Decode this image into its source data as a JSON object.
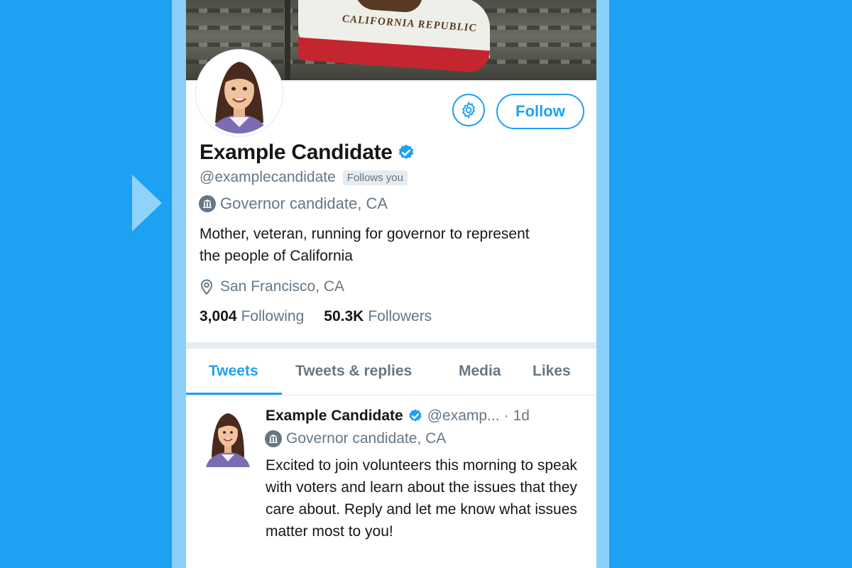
{
  "banner": {
    "flag_text": "CALIFORNIA REPUBLIC"
  },
  "profile": {
    "name": "Example Candidate",
    "handle": "@examplecandidate",
    "follows_you": "Follows you",
    "label": "Governor candidate, CA",
    "bio": "Mother, veteran, running for governor to represent the people of California",
    "location": "San Francisco, CA",
    "following_count": "3,004",
    "following_label": "Following",
    "followers_count": "50.3K",
    "followers_label": "Followers",
    "follow_button": "Follow"
  },
  "tabs": [
    {
      "label": "Tweets",
      "active": true
    },
    {
      "label": "Tweets & replies",
      "active": false
    },
    {
      "label": "Media",
      "active": false
    },
    {
      "label": "Likes",
      "active": false
    }
  ],
  "tweet": {
    "name": "Example Candidate",
    "handle": "@examp...",
    "separator": "·",
    "time": "1d",
    "label": "Governor candidate, CA",
    "text": "Excited to join volunteers this morning to speak with voters and learn about the issues that they care about. Reply and let me know what issues matter most to you!"
  },
  "icons": {
    "settings": "gear-icon",
    "verified": "verified-badge-icon",
    "government": "government-building-icon",
    "location": "location-pin-icon",
    "play_arrow": "play-arrow-icon"
  },
  "colors": {
    "background": "#1da1f2",
    "accent": "#1da1f2",
    "phone_frame": "#8ad0f9",
    "text_primary": "#14171a",
    "text_secondary": "#657786"
  }
}
